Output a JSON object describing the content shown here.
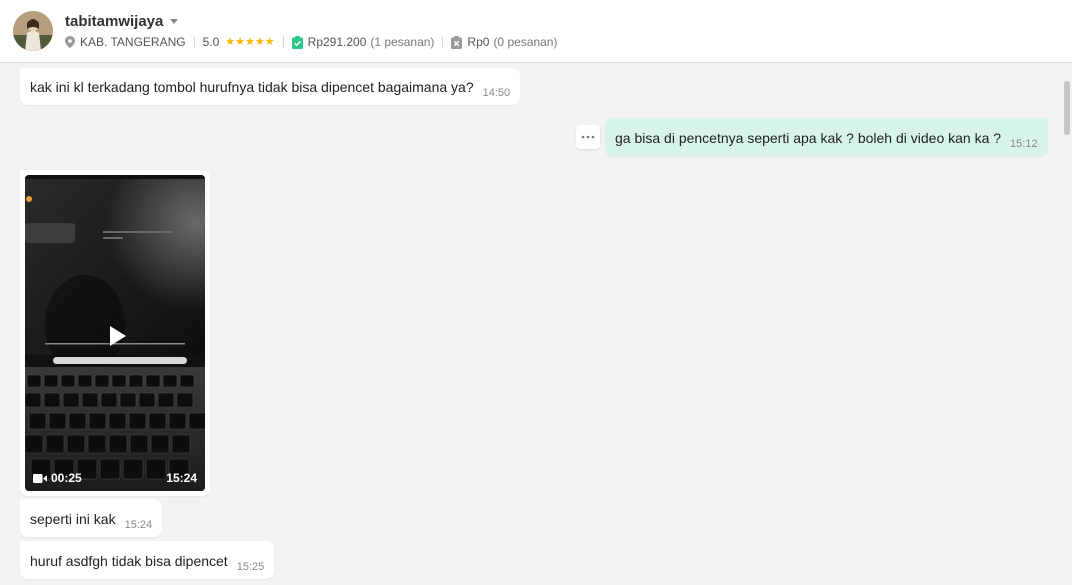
{
  "header": {
    "username": "tabitamwijaya",
    "location": "KAB. TANGERANG",
    "rating": "5.0",
    "stars": 5,
    "spent_amount": "Rp291.200",
    "spent_orders": "(1 pesanan)",
    "cancelled_amount": "Rp0",
    "cancelled_orders": "(0 pesanan)"
  },
  "messages": [
    {
      "direction": "in",
      "text": "kak ini kl terkadang tombol hurufnya tidak bisa dipencet bagaimana ya?",
      "time": "14:50"
    },
    {
      "direction": "out",
      "text": "ga bisa di pencetnya seperti apa kak ? boleh di video kan ka ?",
      "time": "15:12"
    },
    {
      "direction": "in",
      "type": "video",
      "duration": "00:25",
      "time": "15:24"
    },
    {
      "direction": "in",
      "text": "seperti ini kak",
      "time": "15:24"
    },
    {
      "direction": "in",
      "text": "huruf asdfgh tidak bisa dipencet",
      "time": "15:25"
    }
  ],
  "colors": {
    "outgoing_bubble": "#d7f4ec",
    "star": "#f6b800",
    "badge_green": "#2fc78a"
  }
}
